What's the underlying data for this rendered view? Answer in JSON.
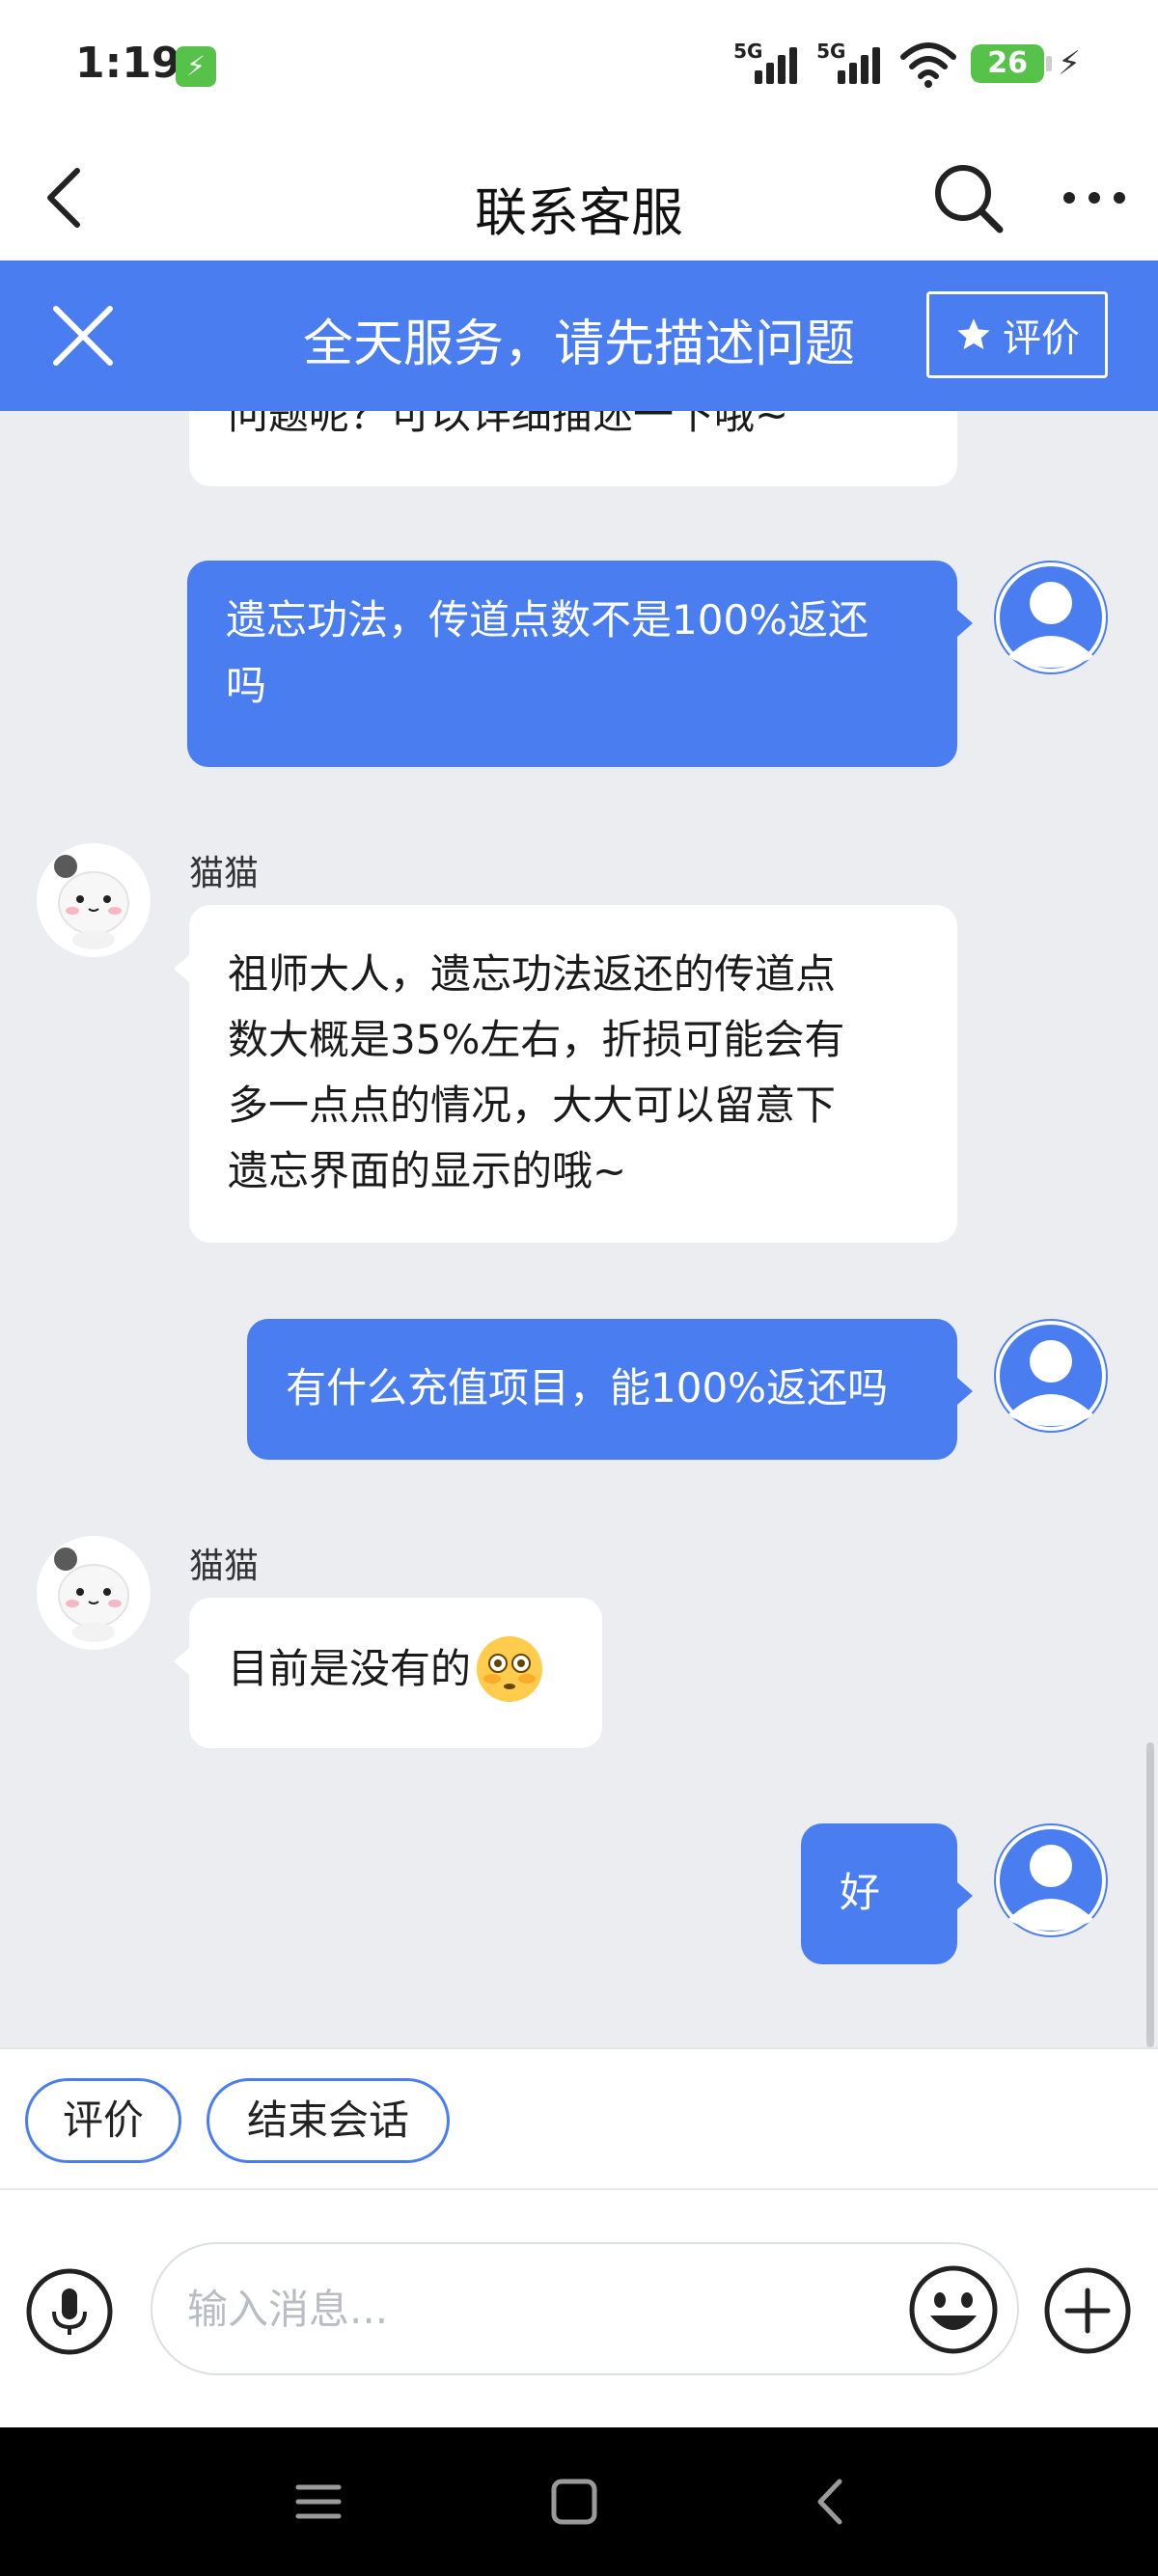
{
  "status_bar": {
    "time": "1:19",
    "charge_icon": "charging-icon",
    "network_1": "5G",
    "network_2": "5G",
    "battery": "26"
  },
  "header": {
    "title": "联系客服",
    "back_icon": "back-arrow-icon",
    "search_icon": "search-icon",
    "more_icon": "more-icon"
  },
  "banner": {
    "text": "全天服务，请先描述问题",
    "rate_label": "评价",
    "close_icon": "close-icon",
    "star_icon": "star-icon",
    "color": "#4a7ef0"
  },
  "messages": [
    {
      "from": "agent",
      "text_lines": [
        "问题呢？可以详细描述一下哦~"
      ],
      "partial": true
    },
    {
      "from": "user",
      "text_lines": [
        "遗忘功法，传道点数不是100%返还",
        "吗"
      ]
    },
    {
      "from": "agent",
      "sender": "猫猫",
      "text_lines": [
        "祖师大人，遗忘功法返还的传道点",
        "数大概是35%左右，折损可能会有",
        "多一点点的情况，大大可以留意下",
        "遗忘界面的显示的哦~"
      ]
    },
    {
      "from": "user",
      "text_lines": [
        "有什么充值项目，能100%返还吗"
      ]
    },
    {
      "from": "agent",
      "sender": "猫猫",
      "text_lines": [
        "目前是没有的"
      ],
      "emoji": "flushed-face-emoji"
    },
    {
      "from": "user",
      "text_lines": [
        "好"
      ]
    }
  ],
  "quick_replies": [
    "评价",
    "结束会话"
  ],
  "input": {
    "placeholder": "输入消息...",
    "value": ""
  },
  "nav": {
    "menu_icon": "menu-icon",
    "home_icon": "home-icon",
    "back_icon": "nav-back-icon"
  },
  "colors": {
    "accent": "#4a7ef0",
    "background": "#ebedf0",
    "agent_bubble": "#ffffff"
  }
}
